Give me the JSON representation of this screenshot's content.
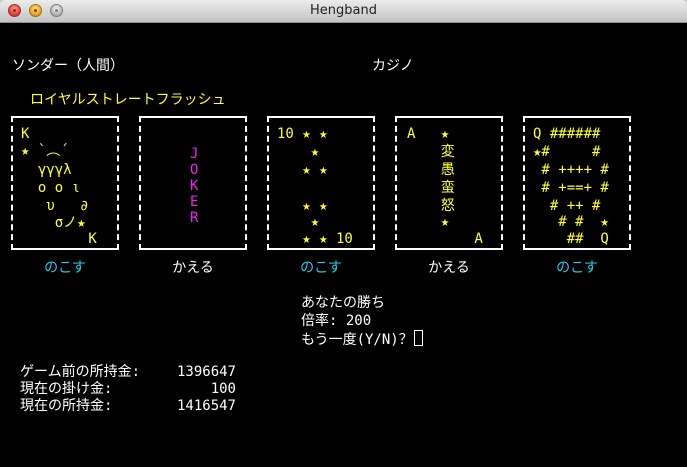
{
  "window": {
    "title": "Hengband"
  },
  "status": {
    "player": "ソンダー（人間）",
    "location": "カジノ"
  },
  "hand_name": "ロイヤルストレートフラッシュ",
  "cards": [
    {
      "lines": [
        "K",
        "★ `︵´",
        "  γγγλ",
        "  ο ο ι",
        "   υ   ∂",
        "    σノ★",
        "        K"
      ],
      "choice": "のこす"
    },
    {
      "lines": [
        "J",
        "O",
        "K",
        "E",
        "R"
      ],
      "choice": "かえる"
    },
    {
      "lines": [
        "10 ★ ★",
        "    ★",
        "   ★ ★",
        "",
        "   ★ ★",
        "    ★",
        "   ★ ★ 10"
      ],
      "choice": "のこす"
    },
    {
      "lines": [
        "A   ★",
        "    変",
        "    愚",
        "    蛮",
        "    怒",
        "    ★",
        "        A"
      ],
      "choice": "かえる"
    },
    {
      "lines": [
        "Q ######",
        "★#     #",
        " # ++++ #",
        " # +==+ #",
        "  # ++ #",
        "   # #  ★",
        "    ##  Q"
      ],
      "choice": "のこす"
    }
  ],
  "result": {
    "message": "あなたの勝ち",
    "multiplier": "倍率: 200",
    "prompt": "もう一度(Y/N)？"
  },
  "money": [
    {
      "label": "ゲーム前の所持金:",
      "value": "1396647"
    },
    {
      "label": "現在の掛け金:",
      "value": "100"
    },
    {
      "label": "現在の所持金:",
      "value": "1416547"
    }
  ],
  "colors": {
    "yellow": "#ffff33",
    "cyan": "#22d3ee",
    "magenta": "#ee22ee",
    "white": "#ffffff",
    "background": "#000000"
  }
}
